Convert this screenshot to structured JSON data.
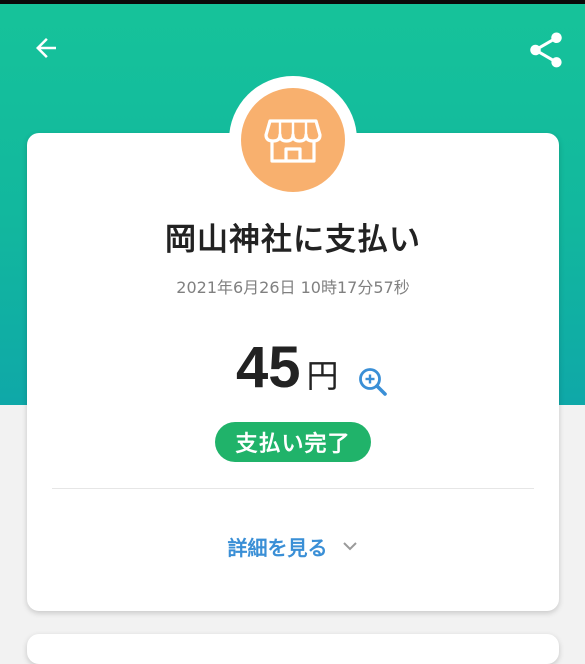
{
  "header": {
    "back_icon": "arrow-left-icon",
    "share_icon": "share-icon"
  },
  "merchant": {
    "icon": "storefront-icon",
    "name": "岡山神社に支払い"
  },
  "payment": {
    "datetime": "2021年6月26日 10時17分57秒",
    "amount": "45",
    "currency": "円",
    "zoom_icon": "zoom-in-icon",
    "status": "支払い完了"
  },
  "details": {
    "label": "詳細を見る",
    "chevron_icon": "chevron-down-icon"
  },
  "colors": {
    "header_gradient_top": "#16c39a",
    "header_gradient_bottom": "#0fa8a8",
    "avatar_bg": "#f8b06e",
    "status_green": "#20b36a",
    "link_blue": "#3a8fd6"
  }
}
